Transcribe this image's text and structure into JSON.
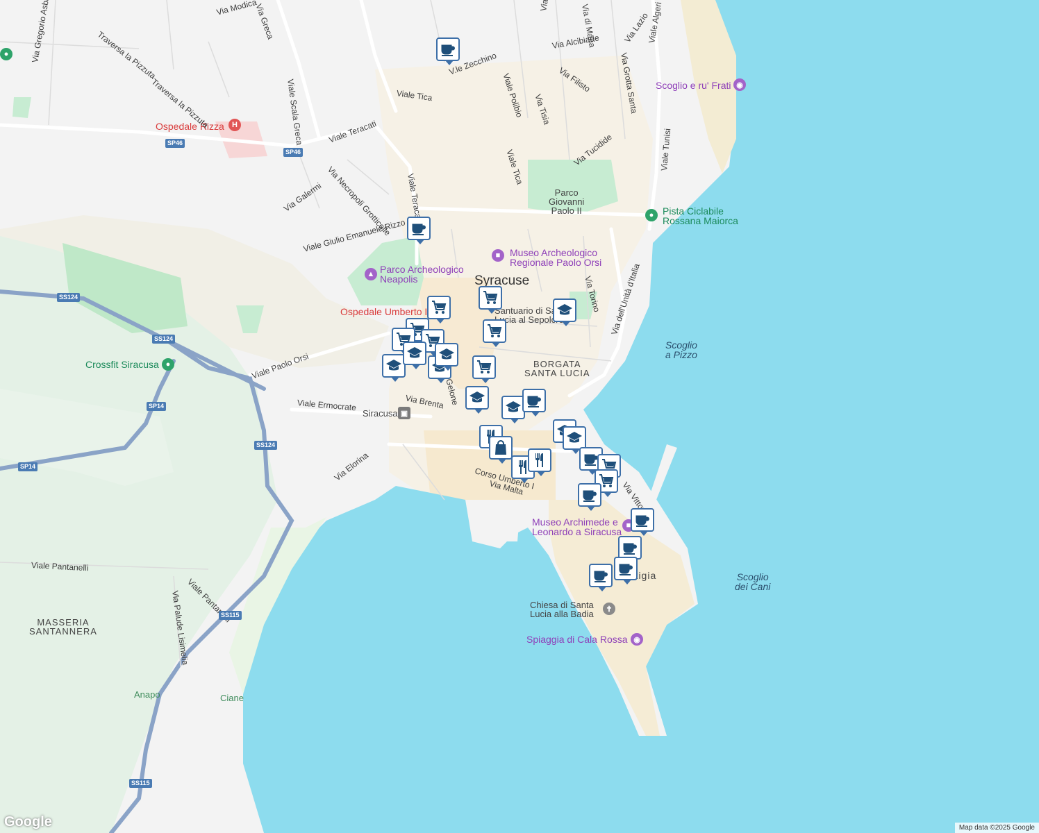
{
  "city_label": "Syracuse",
  "district_label": "BORGATA\nSANTA LUCIA",
  "district_lines": [
    "BORGATA",
    "SANTA LUCIA"
  ],
  "ortigia_label": "Ortigia",
  "masseria_lines": [
    "MASSERIA",
    "SANTANNERA"
  ],
  "streets": {
    "via_gregorio": "Via Gregorio Asba",
    "via_modica": "Via Modica",
    "via_grecia": "Via Greca",
    "traversa1": "Traversa la Pizzuta",
    "traversa2": "Traversa la Pizzuta",
    "viale_scala_greca": "Viale Scala Greca",
    "viale_teracati_h": "Viale Teracati",
    "via_necropoli": "Via Necropoli Grotticelle",
    "via_galermi": "Via Galermi",
    "viale_giulio": "Viale Giulio Emanuele Rizzo",
    "viale_teracati_v": "Viale Teracati",
    "viale_tica": "Viale Tica",
    "vle_zecchino": "V.le Zecchino",
    "viale_polibio": "Viale Polibio",
    "via_tisia": "Via Tisia",
    "via_filisto_v": "Via Filisto",
    "via_filisto": "Via Filisto",
    "via_alcibiade": "Via Alcibiade",
    "viale_tica2": "Viale Tica",
    "via_tucidide": "Via Tucidide",
    "via_grotta_santa": "Via Grotta Santa",
    "via_lazio": "Via Lazio",
    "viale_algeri": "Viale Algeri",
    "viale_tunisi": "Viale Tunisi",
    "via_torino": "Via Torino",
    "via_unita": "Via dell'Unità d'Italia",
    "viale_paolo_orsi": "Viale Paolo Orsi",
    "viale_ermocrate": "Viale Ermocrate",
    "via_brenta": "Via Brenta",
    "via_elorina": "Via Elorina",
    "corso_umberto": "Corso Umberto I",
    "via_malta": "Via Malta",
    "via_vittorio": "Via Vittorio",
    "viale_pantanelli": "Viale Pantanelli",
    "viale_pantanelli2": "Viale Pantanelli",
    "via_palude": "Via Palude Lisimelia",
    "via_di_maria": "Via di Maria",
    "gelone": "Gelone"
  },
  "road_shields": [
    "SP46",
    "SP46",
    "SS124",
    "SS124",
    "SP14",
    "SP14",
    "SS124",
    "SS115",
    "SS115"
  ],
  "places": {
    "ospedale_rizza": "Ospedale Rizza",
    "ospedale_umberto": "Ospedale Umberto I",
    "parco_neapolis": "Parco Archeologico\nNeapolis",
    "parco_neapolis_lines": [
      "Parco Archeologico",
      "Neapolis"
    ],
    "museo_orsi_lines": [
      "Museo Archeologico",
      "Regionale Paolo Orsi"
    ],
    "parco_gp_lines": [
      "Parco",
      "Giovanni",
      "Paolo II"
    ],
    "pista_lines": [
      "Pista Ciclabile",
      "Rossana Maiorca"
    ],
    "scoglio_frati": "Scoglio e ru' Frati",
    "santuario_lines": [
      "Santuario di Santa",
      "Lucia al Sepolcro"
    ],
    "crossfit": "Crossfit Siracusa",
    "siracusa_station": "Siracusa",
    "museo_archimede_lines": [
      "Museo Archimede e",
      "Leonardo a Siracusa"
    ],
    "chiesa_lines": [
      "Chiesa di Santa",
      "Lucia alla Badia"
    ],
    "spiaggia": "Spiaggia di Cala Rossa",
    "scoglio_pizzo_lines": [
      "Scoglio",
      "a Pizzo"
    ],
    "scoglio_cani_lines": [
      "Scoglio",
      "dei Cani"
    ],
    "anapo": "Anapo",
    "ciane": "Ciane"
  },
  "markers": [
    {
      "type": "cafe-icon"
    },
    {
      "type": "cafe-icon"
    },
    {
      "type": "cart-icon"
    },
    {
      "type": "cart-icon"
    },
    {
      "type": "cart-icon"
    },
    {
      "type": "cart-icon"
    },
    {
      "type": "cart-icon"
    },
    {
      "type": "cart-icon"
    },
    {
      "type": "school-icon"
    },
    {
      "type": "school-icon"
    },
    {
      "type": "school-icon"
    },
    {
      "type": "school-icon"
    },
    {
      "type": "cart-icon"
    },
    {
      "type": "school-icon"
    },
    {
      "type": "school-icon"
    },
    {
      "type": "school-icon"
    },
    {
      "type": "cafe-icon"
    },
    {
      "type": "restaurant-icon"
    },
    {
      "type": "shopping-bag-icon"
    },
    {
      "type": "restaurant-icon"
    },
    {
      "type": "restaurant-icon"
    },
    {
      "type": "school-icon"
    },
    {
      "type": "school-icon"
    },
    {
      "type": "cafe-icon"
    },
    {
      "type": "cart-icon"
    },
    {
      "type": "cart-icon"
    },
    {
      "type": "cafe-icon"
    },
    {
      "type": "cafe-icon"
    },
    {
      "type": "cafe-icon"
    },
    {
      "type": "cafe-icon"
    },
    {
      "type": "cafe-icon"
    }
  ],
  "footer": {
    "attribution": "Map data ©2025 Google",
    "logo": "Google"
  },
  "colors": {
    "sea": "#8ddcee",
    "land": "#f3f3f3",
    "park": "#c7ecd2",
    "urban": "#f4ecd7",
    "highway": "#8aa3c7",
    "marker_border": "#3d6fa8",
    "poi_purple": "#8e3fb8",
    "hospital_red": "#d93b3b",
    "green_poi": "#1b8a5a"
  }
}
